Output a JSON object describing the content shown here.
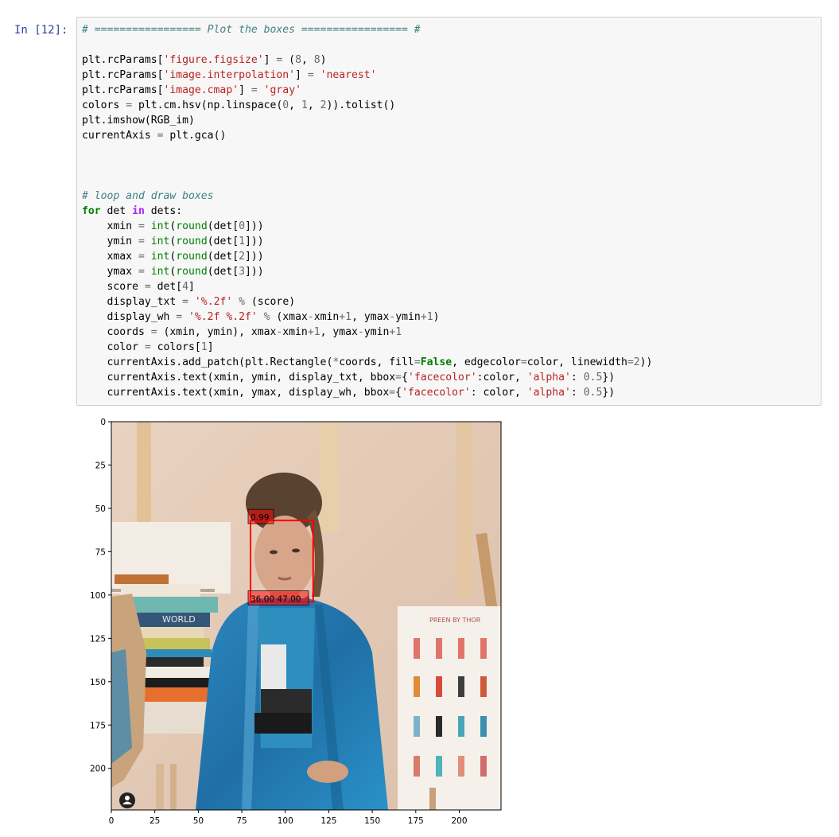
{
  "cell": {
    "prompt": "In [12]:",
    "code_lines": [
      [
        {
          "t": "# ================= Plot the boxes ================= #",
          "c": "cm"
        }
      ],
      [],
      [
        {
          "t": "plt.rcParams["
        },
        {
          "t": "'figure.figsize'",
          "c": "st"
        },
        {
          "t": "] "
        },
        {
          "t": "=",
          "c": "op"
        },
        {
          "t": " ("
        },
        {
          "t": "8",
          "c": "nu"
        },
        {
          "t": ", "
        },
        {
          "t": "8",
          "c": "nu"
        },
        {
          "t": ")"
        }
      ],
      [
        {
          "t": "plt.rcParams["
        },
        {
          "t": "'image.interpolation'",
          "c": "st"
        },
        {
          "t": "] "
        },
        {
          "t": "=",
          "c": "op"
        },
        {
          "t": " "
        },
        {
          "t": "'nearest'",
          "c": "st"
        }
      ],
      [
        {
          "t": "plt.rcParams["
        },
        {
          "t": "'image.cmap'",
          "c": "st"
        },
        {
          "t": "] "
        },
        {
          "t": "=",
          "c": "op"
        },
        {
          "t": " "
        },
        {
          "t": "'gray'",
          "c": "st"
        }
      ],
      [
        {
          "t": "colors "
        },
        {
          "t": "=",
          "c": "op"
        },
        {
          "t": " plt.cm.hsv(np.linspace("
        },
        {
          "t": "0",
          "c": "nu"
        },
        {
          "t": ", "
        },
        {
          "t": "1",
          "c": "nu"
        },
        {
          "t": ", "
        },
        {
          "t": "2",
          "c": "nu"
        },
        {
          "t": ")).tolist()"
        }
      ],
      [
        {
          "t": "plt.imshow(RGB_im)"
        }
      ],
      [
        {
          "t": "currentAxis "
        },
        {
          "t": "=",
          "c": "op"
        },
        {
          "t": " plt.gca()"
        }
      ],
      [],
      [],
      [],
      [
        {
          "t": "# loop and draw boxes",
          "c": "cm"
        }
      ],
      [
        {
          "t": "for",
          "c": "kw"
        },
        {
          "t": " det "
        },
        {
          "t": "in",
          "c": "ow"
        },
        {
          "t": " dets:"
        }
      ],
      [
        {
          "t": "    xmin "
        },
        {
          "t": "=",
          "c": "op"
        },
        {
          "t": " "
        },
        {
          "t": "int",
          "c": "bi"
        },
        {
          "t": "("
        },
        {
          "t": "round",
          "c": "bi"
        },
        {
          "t": "(det["
        },
        {
          "t": "0",
          "c": "nu"
        },
        {
          "t": "]))"
        }
      ],
      [
        {
          "t": "    ymin "
        },
        {
          "t": "=",
          "c": "op"
        },
        {
          "t": " "
        },
        {
          "t": "int",
          "c": "bi"
        },
        {
          "t": "("
        },
        {
          "t": "round",
          "c": "bi"
        },
        {
          "t": "(det["
        },
        {
          "t": "1",
          "c": "nu"
        },
        {
          "t": "]))"
        }
      ],
      [
        {
          "t": "    xmax "
        },
        {
          "t": "=",
          "c": "op"
        },
        {
          "t": " "
        },
        {
          "t": "int",
          "c": "bi"
        },
        {
          "t": "("
        },
        {
          "t": "round",
          "c": "bi"
        },
        {
          "t": "(det["
        },
        {
          "t": "2",
          "c": "nu"
        },
        {
          "t": "]))"
        }
      ],
      [
        {
          "t": "    ymax "
        },
        {
          "t": "=",
          "c": "op"
        },
        {
          "t": " "
        },
        {
          "t": "int",
          "c": "bi"
        },
        {
          "t": "("
        },
        {
          "t": "round",
          "c": "bi"
        },
        {
          "t": "(det["
        },
        {
          "t": "3",
          "c": "nu"
        },
        {
          "t": "]))"
        }
      ],
      [
        {
          "t": "    score "
        },
        {
          "t": "=",
          "c": "op"
        },
        {
          "t": " det["
        },
        {
          "t": "4",
          "c": "nu"
        },
        {
          "t": "]"
        }
      ],
      [
        {
          "t": "    display_txt "
        },
        {
          "t": "=",
          "c": "op"
        },
        {
          "t": " "
        },
        {
          "t": "'%.2f'",
          "c": "st"
        },
        {
          "t": " "
        },
        {
          "t": "%",
          "c": "op"
        },
        {
          "t": " (score)"
        }
      ],
      [
        {
          "t": "    display_wh "
        },
        {
          "t": "=",
          "c": "op"
        },
        {
          "t": " "
        },
        {
          "t": "'%.2f %.2f'",
          "c": "st"
        },
        {
          "t": " "
        },
        {
          "t": "%",
          "c": "op"
        },
        {
          "t": " (xmax"
        },
        {
          "t": "-",
          "c": "op"
        },
        {
          "t": "xmin"
        },
        {
          "t": "+",
          "c": "op"
        },
        {
          "t": "1",
          "c": "nu"
        },
        {
          "t": ", ymax"
        },
        {
          "t": "-",
          "c": "op"
        },
        {
          "t": "ymin"
        },
        {
          "t": "+",
          "c": "op"
        },
        {
          "t": "1",
          "c": "nu"
        },
        {
          "t": ")"
        }
      ],
      [
        {
          "t": "    coords "
        },
        {
          "t": "=",
          "c": "op"
        },
        {
          "t": " (xmin, ymin), xmax"
        },
        {
          "t": "-",
          "c": "op"
        },
        {
          "t": "xmin"
        },
        {
          "t": "+",
          "c": "op"
        },
        {
          "t": "1",
          "c": "nu"
        },
        {
          "t": ", ymax"
        },
        {
          "t": "-",
          "c": "op"
        },
        {
          "t": "ymin"
        },
        {
          "t": "+",
          "c": "op"
        },
        {
          "t": "1",
          "c": "nu"
        }
      ],
      [
        {
          "t": "    color "
        },
        {
          "t": "=",
          "c": "op"
        },
        {
          "t": " colors["
        },
        {
          "t": "1",
          "c": "nu"
        },
        {
          "t": "]"
        }
      ],
      [
        {
          "t": "    currentAxis.add_patch(plt.Rectangle("
        },
        {
          "t": "*",
          "c": "op"
        },
        {
          "t": "coords, fill"
        },
        {
          "t": "=",
          "c": "op"
        },
        {
          "t": "False",
          "c": "kw"
        },
        {
          "t": ", edgecolor"
        },
        {
          "t": "=",
          "c": "op"
        },
        {
          "t": "color, linewidth"
        },
        {
          "t": "=",
          "c": "op"
        },
        {
          "t": "2",
          "c": "nu"
        },
        {
          "t": "))"
        }
      ],
      [
        {
          "t": "    currentAxis.text(xmin, ymin, display_txt, bbox"
        },
        {
          "t": "=",
          "c": "op"
        },
        {
          "t": "{"
        },
        {
          "t": "'facecolor'",
          "c": "st"
        },
        {
          "t": ":color, "
        },
        {
          "t": "'alpha'",
          "c": "st"
        },
        {
          "t": ": "
        },
        {
          "t": "0.5",
          "c": "nu"
        },
        {
          "t": "})"
        }
      ],
      [
        {
          "t": "    currentAxis.text(xmin, ymax, display_wh, bbox"
        },
        {
          "t": "=",
          "c": "op"
        },
        {
          "t": "{"
        },
        {
          "t": "'facecolor'",
          "c": "st"
        },
        {
          "t": ": color, "
        },
        {
          "t": "'alpha'",
          "c": "st"
        },
        {
          "t": ": "
        },
        {
          "t": "0.5",
          "c": "nu"
        },
        {
          "t": "})"
        }
      ]
    ]
  },
  "output": {
    "image_alt": "Photo of a person in a blue jacket with a detection box",
    "book_texts": [
      "WORLD",
      "PREEN BY THOR"
    ],
    "detection": {
      "score_label": "0.99",
      "wh_label": "36.00 47.00",
      "xmin": 80,
      "ymin": 57,
      "xmax": 116,
      "ymax": 104,
      "color": "#ff0000"
    }
  },
  "chart_data": {
    "type": "image",
    "xlim": [
      0,
      224
    ],
    "ylim": [
      224,
      0
    ],
    "x_ticks": [
      0,
      25,
      50,
      75,
      100,
      125,
      150,
      175,
      200
    ],
    "y_ticks": [
      0,
      25,
      50,
      75,
      100,
      125,
      150,
      175,
      200
    ],
    "x_tick_labels": [
      "0",
      "25",
      "50",
      "75",
      "100",
      "125",
      "150",
      "175",
      "200"
    ],
    "y_tick_labels": [
      "0",
      "25",
      "50",
      "75",
      "100",
      "125",
      "150",
      "175",
      "200"
    ]
  }
}
